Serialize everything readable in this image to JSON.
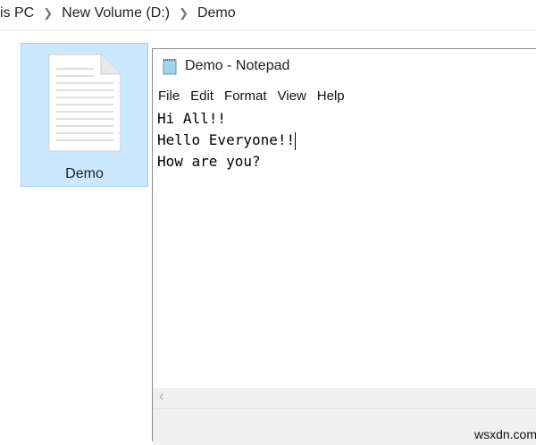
{
  "breadcrumb": [
    "is PC",
    "New Volume (D:)",
    "Demo"
  ],
  "file": {
    "name": "Demo"
  },
  "notepad": {
    "title": "Demo - Notepad",
    "menu": [
      "File",
      "Edit",
      "Format",
      "View",
      "Help"
    ],
    "lines": [
      "Hi All!!",
      "Hello Everyone!!",
      "How are you?"
    ]
  },
  "watermark": "wsxdn.com"
}
